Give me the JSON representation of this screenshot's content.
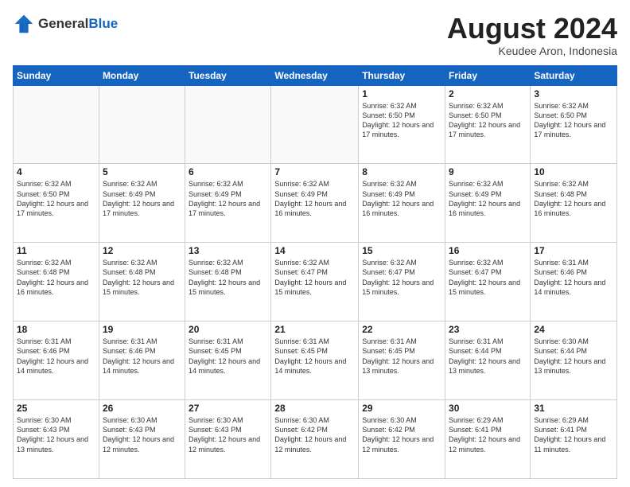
{
  "header": {
    "logo_general": "General",
    "logo_blue": "Blue",
    "month_title": "August 2024",
    "subtitle": "Keudee Aron, Indonesia"
  },
  "days": [
    "Sunday",
    "Monday",
    "Tuesday",
    "Wednesday",
    "Thursday",
    "Friday",
    "Saturday"
  ],
  "weeks": [
    [
      {
        "day": "",
        "text": ""
      },
      {
        "day": "",
        "text": ""
      },
      {
        "day": "",
        "text": ""
      },
      {
        "day": "",
        "text": ""
      },
      {
        "day": "1",
        "text": "Sunrise: 6:32 AM\nSunset: 6:50 PM\nDaylight: 12 hours\nand 17 minutes."
      },
      {
        "day": "2",
        "text": "Sunrise: 6:32 AM\nSunset: 6:50 PM\nDaylight: 12 hours\nand 17 minutes."
      },
      {
        "day": "3",
        "text": "Sunrise: 6:32 AM\nSunset: 6:50 PM\nDaylight: 12 hours\nand 17 minutes."
      }
    ],
    [
      {
        "day": "4",
        "text": "Sunrise: 6:32 AM\nSunset: 6:50 PM\nDaylight: 12 hours\nand 17 minutes."
      },
      {
        "day": "5",
        "text": "Sunrise: 6:32 AM\nSunset: 6:49 PM\nDaylight: 12 hours\nand 17 minutes."
      },
      {
        "day": "6",
        "text": "Sunrise: 6:32 AM\nSunset: 6:49 PM\nDaylight: 12 hours\nand 17 minutes."
      },
      {
        "day": "7",
        "text": "Sunrise: 6:32 AM\nSunset: 6:49 PM\nDaylight: 12 hours\nand 16 minutes."
      },
      {
        "day": "8",
        "text": "Sunrise: 6:32 AM\nSunset: 6:49 PM\nDaylight: 12 hours\nand 16 minutes."
      },
      {
        "day": "9",
        "text": "Sunrise: 6:32 AM\nSunset: 6:49 PM\nDaylight: 12 hours\nand 16 minutes."
      },
      {
        "day": "10",
        "text": "Sunrise: 6:32 AM\nSunset: 6:48 PM\nDaylight: 12 hours\nand 16 minutes."
      }
    ],
    [
      {
        "day": "11",
        "text": "Sunrise: 6:32 AM\nSunset: 6:48 PM\nDaylight: 12 hours\nand 16 minutes."
      },
      {
        "day": "12",
        "text": "Sunrise: 6:32 AM\nSunset: 6:48 PM\nDaylight: 12 hours\nand 15 minutes."
      },
      {
        "day": "13",
        "text": "Sunrise: 6:32 AM\nSunset: 6:48 PM\nDaylight: 12 hours\nand 15 minutes."
      },
      {
        "day": "14",
        "text": "Sunrise: 6:32 AM\nSunset: 6:47 PM\nDaylight: 12 hours\nand 15 minutes."
      },
      {
        "day": "15",
        "text": "Sunrise: 6:32 AM\nSunset: 6:47 PM\nDaylight: 12 hours\nand 15 minutes."
      },
      {
        "day": "16",
        "text": "Sunrise: 6:32 AM\nSunset: 6:47 PM\nDaylight: 12 hours\nand 15 minutes."
      },
      {
        "day": "17",
        "text": "Sunrise: 6:31 AM\nSunset: 6:46 PM\nDaylight: 12 hours\nand 14 minutes."
      }
    ],
    [
      {
        "day": "18",
        "text": "Sunrise: 6:31 AM\nSunset: 6:46 PM\nDaylight: 12 hours\nand 14 minutes."
      },
      {
        "day": "19",
        "text": "Sunrise: 6:31 AM\nSunset: 6:46 PM\nDaylight: 12 hours\nand 14 minutes."
      },
      {
        "day": "20",
        "text": "Sunrise: 6:31 AM\nSunset: 6:45 PM\nDaylight: 12 hours\nand 14 minutes."
      },
      {
        "day": "21",
        "text": "Sunrise: 6:31 AM\nSunset: 6:45 PM\nDaylight: 12 hours\nand 14 minutes."
      },
      {
        "day": "22",
        "text": "Sunrise: 6:31 AM\nSunset: 6:45 PM\nDaylight: 12 hours\nand 13 minutes."
      },
      {
        "day": "23",
        "text": "Sunrise: 6:31 AM\nSunset: 6:44 PM\nDaylight: 12 hours\nand 13 minutes."
      },
      {
        "day": "24",
        "text": "Sunrise: 6:30 AM\nSunset: 6:44 PM\nDaylight: 12 hours\nand 13 minutes."
      }
    ],
    [
      {
        "day": "25",
        "text": "Sunrise: 6:30 AM\nSunset: 6:43 PM\nDaylight: 12 hours\nand 13 minutes."
      },
      {
        "day": "26",
        "text": "Sunrise: 6:30 AM\nSunset: 6:43 PM\nDaylight: 12 hours\nand 12 minutes."
      },
      {
        "day": "27",
        "text": "Sunrise: 6:30 AM\nSunset: 6:43 PM\nDaylight: 12 hours\nand 12 minutes."
      },
      {
        "day": "28",
        "text": "Sunrise: 6:30 AM\nSunset: 6:42 PM\nDaylight: 12 hours\nand 12 minutes."
      },
      {
        "day": "29",
        "text": "Sunrise: 6:30 AM\nSunset: 6:42 PM\nDaylight: 12 hours\nand 12 minutes."
      },
      {
        "day": "30",
        "text": "Sunrise: 6:29 AM\nSunset: 6:41 PM\nDaylight: 12 hours\nand 12 minutes."
      },
      {
        "day": "31",
        "text": "Sunrise: 6:29 AM\nSunset: 6:41 PM\nDaylight: 12 hours\nand 11 minutes."
      }
    ]
  ]
}
